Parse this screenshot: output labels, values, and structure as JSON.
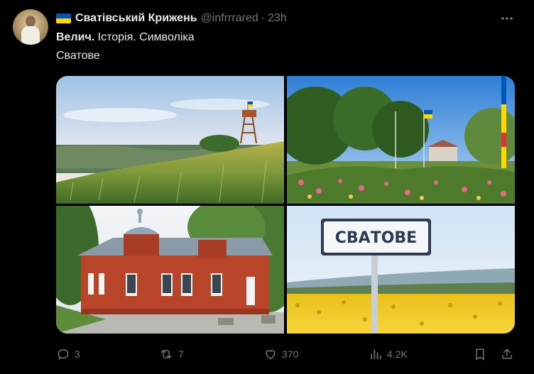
{
  "author": {
    "name": "Сватівський Крижень",
    "handle": "@infrrrared",
    "separator": "·",
    "time": "23h"
  },
  "tweet": {
    "text_bold": "Велич.",
    "text_rest": " Історія. Символіка",
    "text_line2": "Сватове"
  },
  "images": [
    {
      "icon": "hill-watchtower-photo"
    },
    {
      "icon": "park-flowers-flag-photo"
    },
    {
      "icon": "red-brick-building-photo"
    },
    {
      "icon": "town-sign-sunflowers-photo",
      "sign_text": "СВАТОВЕ"
    }
  ],
  "actions": {
    "replies": "3",
    "reposts": "7",
    "likes": "370",
    "views": "4.2K"
  },
  "colors": {
    "background": "#000000",
    "text": "#e7e9ea",
    "muted": "#71767b",
    "flag_blue": "#0057b7",
    "flag_yellow": "#ffd700"
  }
}
